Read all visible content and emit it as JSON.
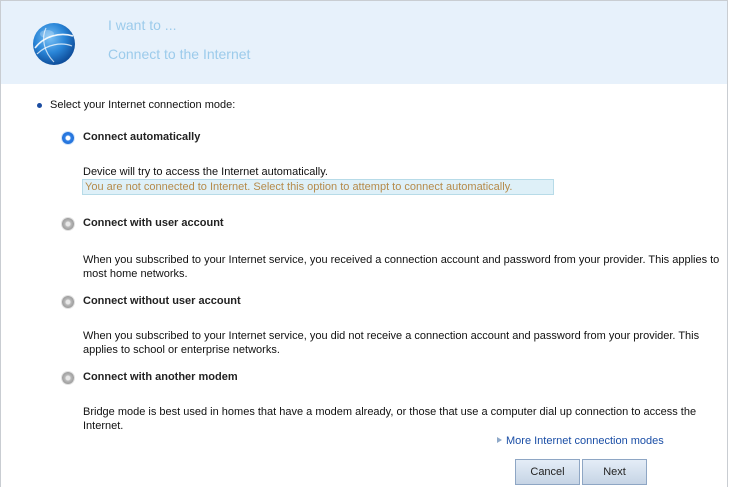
{
  "header": {
    "title": "I want to ...",
    "subtitle": "Connect to the Internet",
    "icon": "globe-icon"
  },
  "prompt": "Select your Internet connection mode:",
  "options": [
    {
      "label": "Connect automatically",
      "selected": true,
      "description": "Device will try to access the Internet automatically.",
      "status": "You are not connected to Internet. Select this option to attempt to connect automatically."
    },
    {
      "label": "Connect with user account",
      "selected": false,
      "description": "When you subscribed to your Internet service, you received a connection account and password from your provider. This applies to most home networks."
    },
    {
      "label": "Connect without user account",
      "selected": false,
      "description": "When you subscribed to your Internet service, you did not receive a connection account and password from your provider. This applies to school or enterprise networks."
    },
    {
      "label": "Connect with another modem",
      "selected": false,
      "description": "Bridge mode is best used in homes that have a modem already, or those that use a computer dial up connection to access the Internet."
    }
  ],
  "more_link": "More Internet connection modes",
  "buttons": {
    "cancel": "Cancel",
    "next": "Next"
  },
  "colors": {
    "header_bg": "#e7f1fb",
    "header_text": "#9ccbeb",
    "status_bg": "#def0f8",
    "status_text": "#b58a4a",
    "link": "#1a4ea6",
    "selected_radio": "#1f6fd8"
  }
}
